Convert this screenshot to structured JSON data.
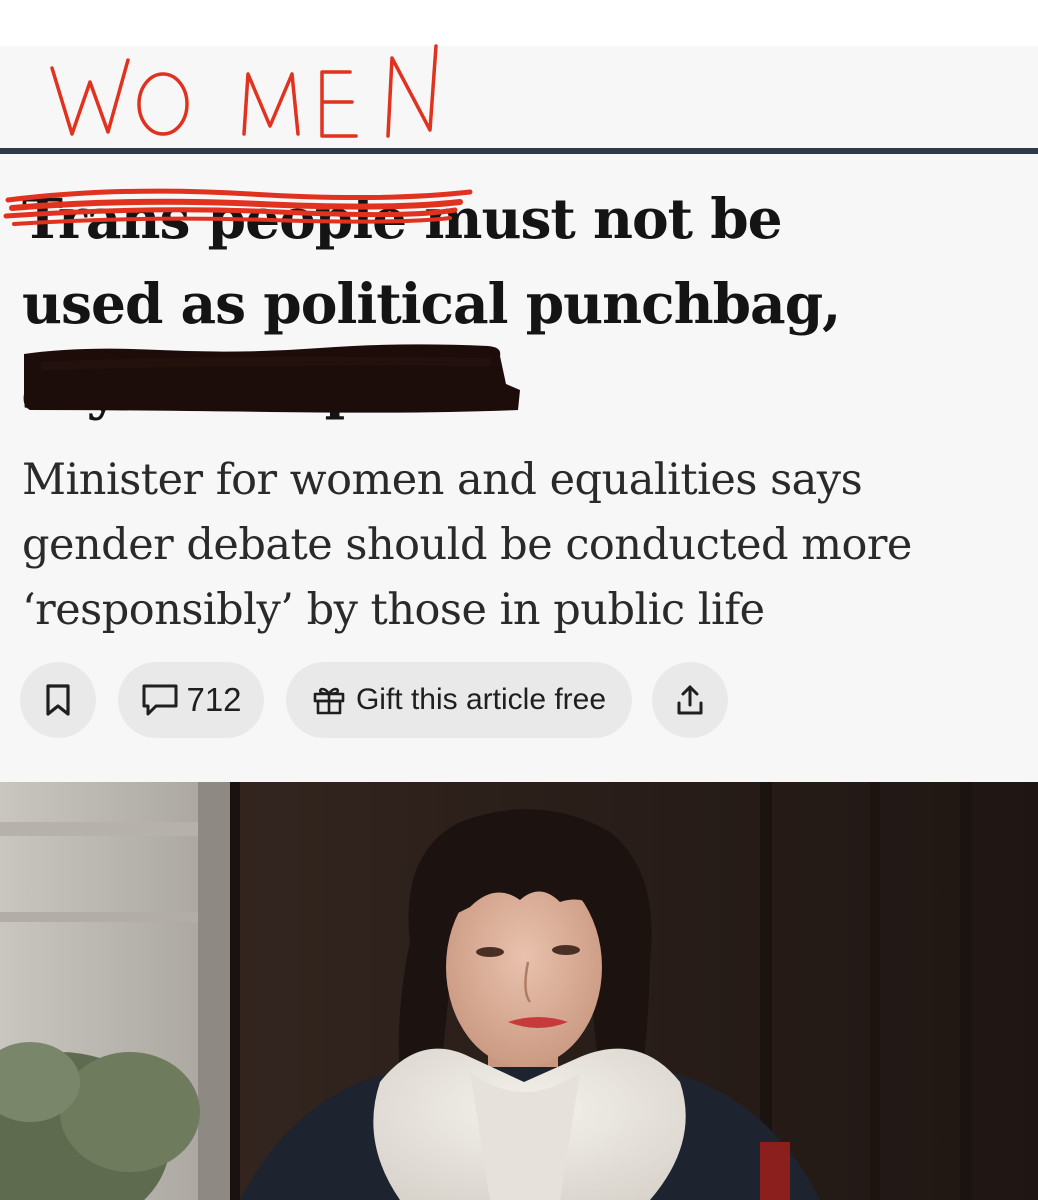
{
  "annotation": {
    "handwritten_word": "WOMEN"
  },
  "article": {
    "headline": {
      "struck_part": "Trans people",
      "line1_rest": " must not be",
      "line2": "used as political punchbag,",
      "line3_redacted": "says Phillipson"
    },
    "standfirst": "Minister for women and equalities says gender debate should be conducted more ‘responsibly’ by those in public life"
  },
  "actions": {
    "comment_count": "712",
    "gift_label": "Gift this article free"
  },
  "icons": {
    "bookmark": "bookmark-icon",
    "comment": "comment-icon",
    "gift": "gift-icon",
    "share": "share-icon"
  },
  "colors": {
    "annotation_red": "#e0321e",
    "rule": "#2f3a4a",
    "redaction": "#1c0d0b",
    "button_bg": "#e9e9e9"
  }
}
